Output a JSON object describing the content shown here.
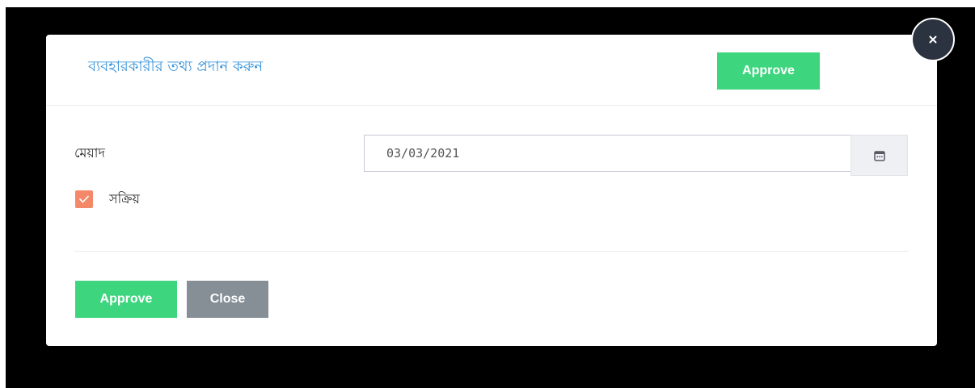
{
  "modal": {
    "title": "ব্যবহারকারীর তথ্য প্রদান করুন",
    "header_approve_label": "Approve",
    "close_icon": "close-icon"
  },
  "form": {
    "duration_label": "মেয়াদ",
    "date_value": "03/03/2021",
    "calendar_icon": "calendar-icon",
    "active_label": "সক্রিয়",
    "active_checked": true
  },
  "footer": {
    "approve_label": "Approve",
    "close_label": "Close"
  },
  "colors": {
    "title": "#2f8fd8",
    "approve": "#3dd57e",
    "close": "#868e96",
    "checkbox": "#f4896a",
    "overlay": "#000000",
    "close_circle": "#2c3340"
  }
}
